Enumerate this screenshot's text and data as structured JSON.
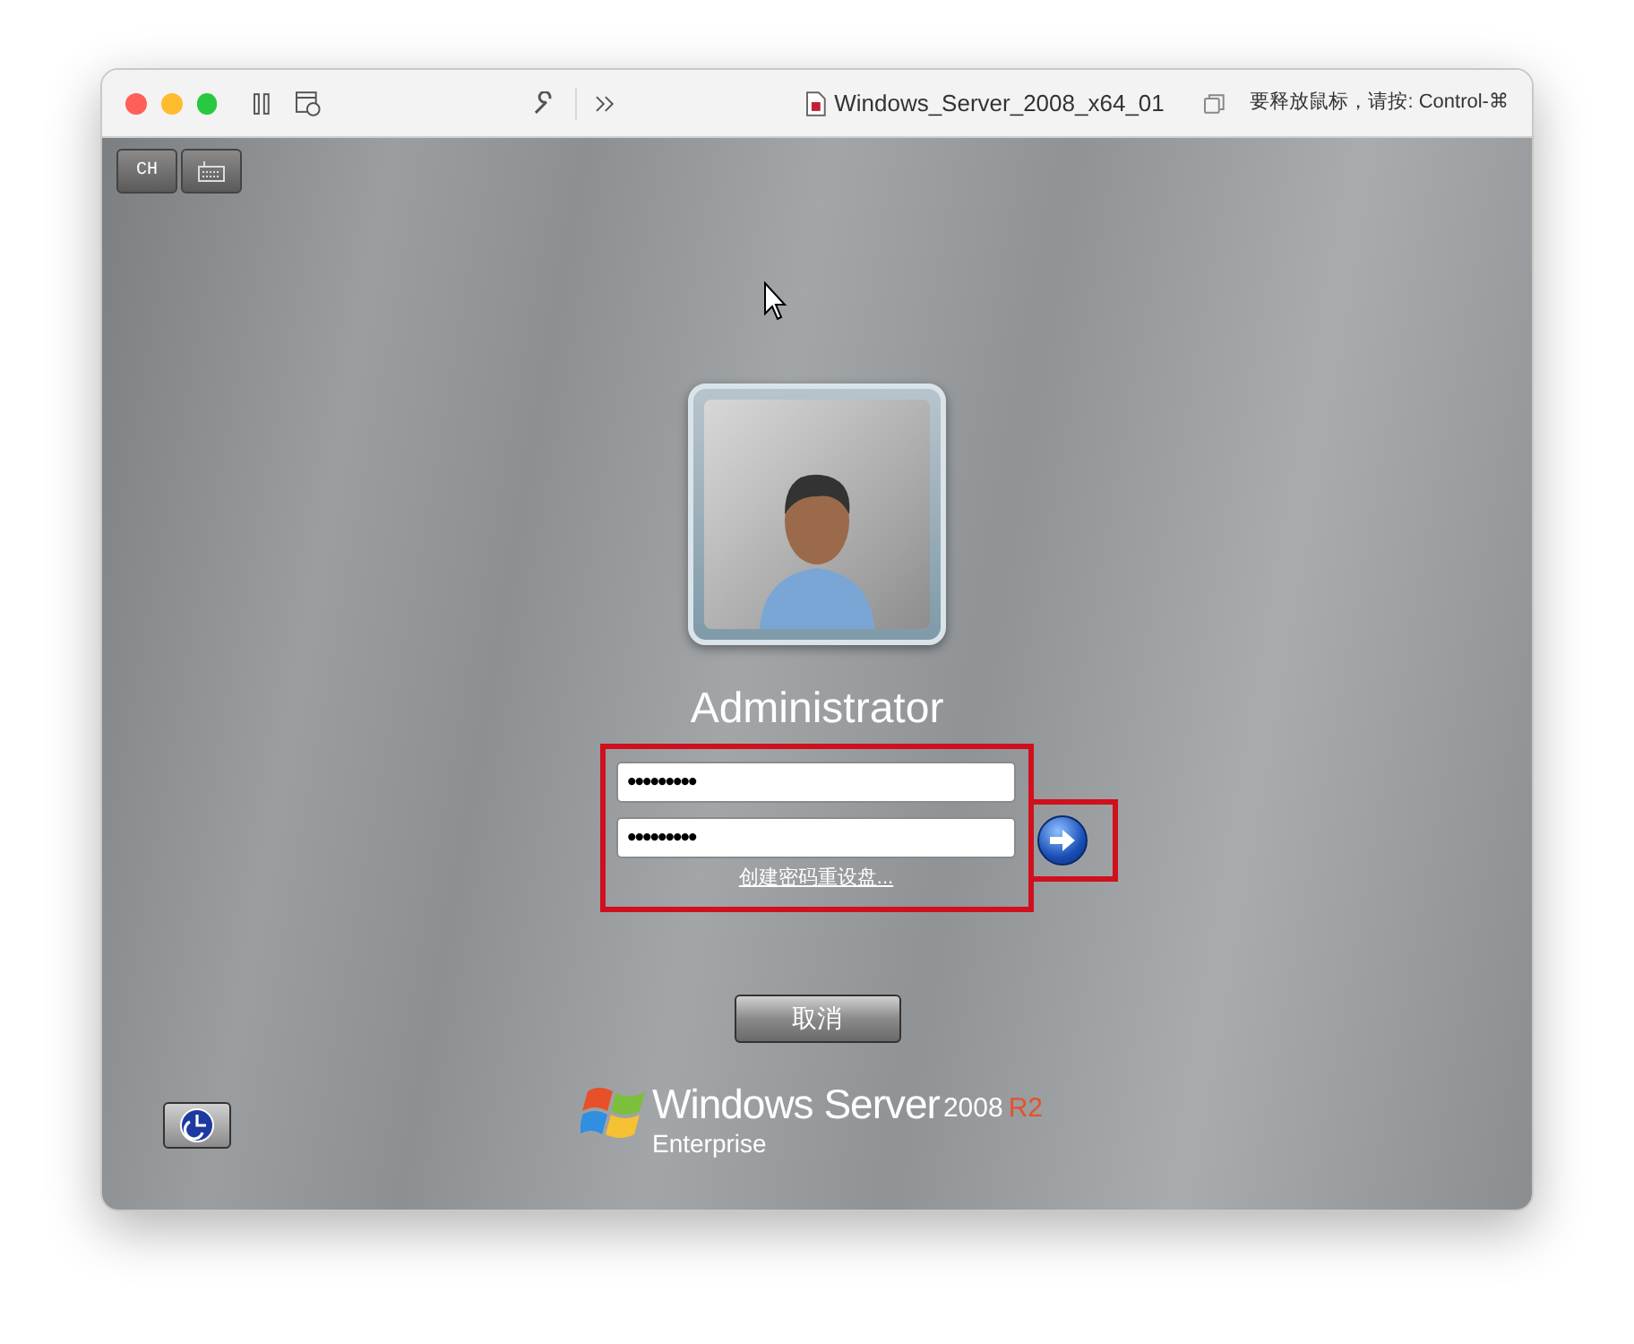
{
  "window": {
    "title": "Windows_Server_2008_x64_01",
    "hint": "要释放鼠标，请按: Control-⌘"
  },
  "toolbar": {
    "language": "CH"
  },
  "login": {
    "user": "Administrator",
    "fields": [
      {
        "value": "•••••••••"
      },
      {
        "value": "•••••••••"
      }
    ],
    "reset_link": "创建密码重设盘...",
    "cancel": "取消"
  },
  "logo": {
    "name": "Windows Server",
    "version": "2008",
    "release": "R2",
    "edition": "Enterprise"
  }
}
